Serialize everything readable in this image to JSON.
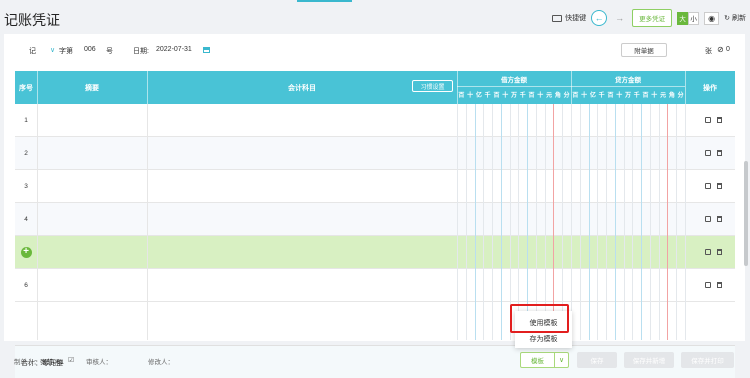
{
  "page": {
    "title": "记账凭证",
    "toolbar": {
      "hotkey_label": "快捷键",
      "prev_icon": "arrow-left-icon",
      "next_icon": "arrow-right-icon",
      "more_vouchers": "更多凭证",
      "size_large": "大",
      "size_small": "小",
      "refresh_label": "刷新"
    }
  },
  "meta": {
    "ji": "记",
    "word_select": "字第",
    "number": "006",
    "hao": "号",
    "date_label": "日期:",
    "date": "2022-07-31",
    "attachment_btn": "附单据",
    "zhang": "张"
  },
  "table": {
    "headers": {
      "seq": "序号",
      "summary": "摘要",
      "subject": "会计科目",
      "template_setting": "习惯设置",
      "debit": "借方金额",
      "credit": "贷方金额",
      "ops": "操作"
    },
    "units": [
      "百",
      "十",
      "亿",
      "千",
      "百",
      "十",
      "万",
      "千",
      "百",
      "十",
      "元",
      "角",
      "分"
    ],
    "rows": [
      {
        "label": "1"
      },
      {
        "label": "2"
      },
      {
        "label": "3"
      },
      {
        "label": "4"
      },
      {
        "label": ""
      },
      {
        "label": "6"
      }
    ],
    "total_label": "合计：零元整"
  },
  "footer": {
    "maker": "制单人：",
    "maker_name": "张楚001",
    "auditor": "审核人：",
    "modifier": "修改人：",
    "template_btn": "模板",
    "save_btn": "保存",
    "save_new_btn": "保存并新增",
    "save_print_btn": "保存并打印"
  },
  "dropdown": {
    "use_template": "使用模板",
    "save_as_template": "存为模板"
  },
  "colors": {
    "header_bg": "#49c3d6",
    "highlight_row": "#d8f0c2",
    "green": "#6ab83c",
    "red_box": "#e21e1e"
  }
}
